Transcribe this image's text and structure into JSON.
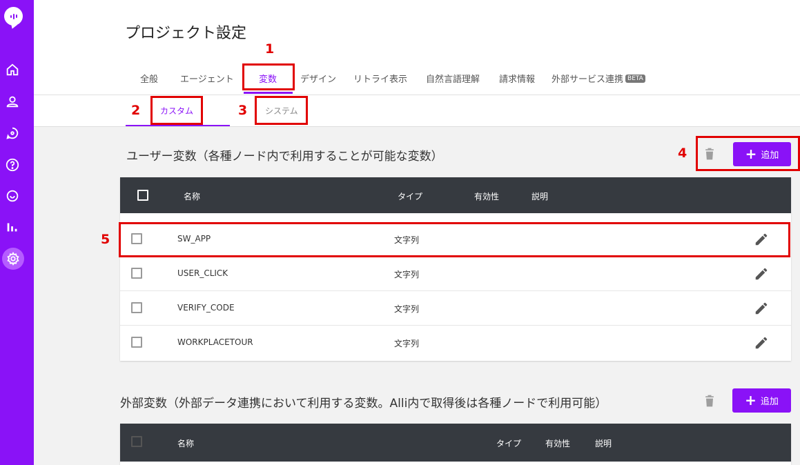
{
  "page": {
    "title": "プロジェクト設定"
  },
  "tabs": [
    {
      "label": "全般"
    },
    {
      "label": "エージェント"
    },
    {
      "label": "変数"
    },
    {
      "label": "デザイン"
    },
    {
      "label": "リトライ表示"
    },
    {
      "label": "自然言語理解"
    },
    {
      "label": "請求情報"
    },
    {
      "label": "外部サービス連携"
    }
  ],
  "beta_badge": "BETA",
  "subtabs": [
    {
      "label": "カスタム"
    },
    {
      "label": "システム"
    }
  ],
  "user_vars": {
    "title": "ユーザー変数（各種ノード内で利用することが可能な変数）",
    "add_label": "追加",
    "headers": {
      "name": "名称",
      "type": "タイプ",
      "validity": "有効性",
      "desc": "説明"
    },
    "rows": [
      {
        "name": "SW_APP",
        "type": "文字列"
      },
      {
        "name": "USER_CLICK",
        "type": "文字列"
      },
      {
        "name": "VERIFY_CODE",
        "type": "文字列"
      },
      {
        "name": "WORKPLACETOUR",
        "type": "文字列"
      }
    ]
  },
  "external_vars": {
    "title": "外部変数（外部データ連携において利用する変数。Alli内で取得後は各種ノードで利用可能）",
    "add_label": "追加",
    "headers": {
      "name": "名称",
      "type": "タイプ",
      "validity": "有効性",
      "desc": "説明"
    }
  },
  "annotations": [
    "1",
    "2",
    "3",
    "4",
    "5"
  ],
  "colors": {
    "accent": "#8a12f7",
    "annotation": "#e10000",
    "table_header": "#363a40"
  },
  "icons": [
    "logo-icon",
    "home-icon",
    "user-icon",
    "chat-icon",
    "help-icon",
    "search-chat-icon",
    "analytics-icon",
    "settings-icon",
    "trash-icon",
    "plus-icon",
    "edit-icon"
  ]
}
